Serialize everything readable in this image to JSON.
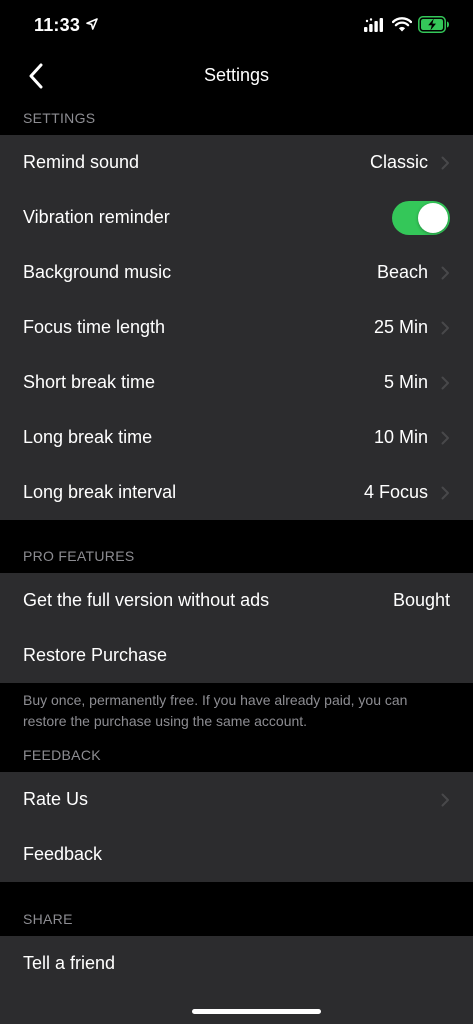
{
  "status_bar": {
    "time": "11:33",
    "icons": [
      "location-arrow-icon",
      "cellular-signal-icon",
      "wifi-icon",
      "battery-charging-icon"
    ]
  },
  "nav": {
    "title": "Settings",
    "back_icon": "chevron-left-icon"
  },
  "sections": {
    "settings": {
      "header": "SETTINGS",
      "remind_sound": {
        "label": "Remind sound",
        "value": "Classic"
      },
      "vibration": {
        "label": "Vibration reminder",
        "on": true
      },
      "background_music": {
        "label": "Background music",
        "value": "Beach"
      },
      "focus_time": {
        "label": "Focus time length",
        "value": "25 Min"
      },
      "short_break": {
        "label": "Short break time",
        "value": "5 Min"
      },
      "long_break": {
        "label": "Long break time",
        "value": "10 Min"
      },
      "long_break_interval": {
        "label": "Long break interval",
        "value": "4 Focus"
      }
    },
    "pro": {
      "header": "PRO FEATURES",
      "full_version": {
        "label": "Get the full version without ads",
        "value": "Bought"
      },
      "restore": {
        "label": "Restore Purchase"
      },
      "footnote": "Buy once, permanently free. If you have already paid, you can restore the purchase using the same account."
    },
    "feedback": {
      "header": "FEEDBACK",
      "rate_us": {
        "label": "Rate Us"
      },
      "feedback": {
        "label": "Feedback"
      }
    },
    "share": {
      "header": "SHARE",
      "tell_friend": {
        "label": "Tell a friend"
      }
    }
  },
  "colors": {
    "background": "#000000",
    "cell": "#2c2c2e",
    "toggle_on": "#34c759",
    "secondary_text": "#8d8d92",
    "battery_fill": "#34c759"
  }
}
